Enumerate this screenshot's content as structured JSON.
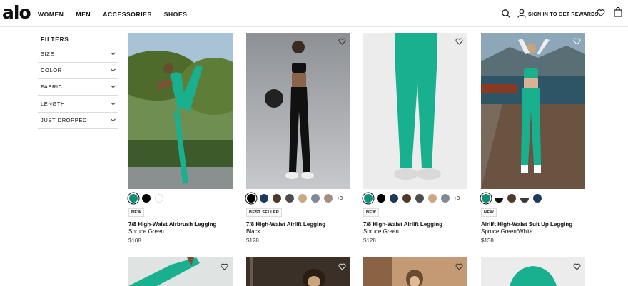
{
  "header": {
    "logo": "alo",
    "nav": [
      "WOMEN",
      "MEN",
      "ACCESSORIES",
      "SHOES"
    ],
    "signin": "SIGN IN TO GET REWARDS"
  },
  "filters": {
    "title": "FILTERS",
    "items": [
      "SIZE",
      "COLOR",
      "FABRIC",
      "LENGTH",
      "JUST DROPPED"
    ]
  },
  "products": [
    {
      "name": "7/8 High-Waist Airbrush Legging",
      "color": "Spruce Green",
      "price": "$108",
      "badge": "NEW",
      "swatches": [
        "#0f8f77",
        "#000000",
        "#ffffff"
      ],
      "more": ""
    },
    {
      "name": "7/8 High-Waist Airlift Legging",
      "color": "Black",
      "price": "$128",
      "badge": "BEST SELLER",
      "swatches": [
        "#000000",
        "#1b3a5c",
        "#4f3a2a",
        "#4d4d4d",
        "#c9a982",
        "#7f8a96",
        "#a48e83"
      ],
      "more": "+3"
    },
    {
      "name": "7/8 High-Waist Airlift Legging",
      "color": "Spruce Green",
      "price": "$128",
      "badge": "NEW",
      "swatches": [
        "#0f8f77",
        "#000000",
        "#1b3a5c",
        "#4f3a2a",
        "#4d4d4d",
        "#c9a982",
        "#7f8a96"
      ],
      "more": "+3"
    },
    {
      "name": "Airlift High-Waist Suit Up Legging",
      "color": "Spruce Green/White",
      "price": "$138",
      "badge": "NEW",
      "swatches": [
        "#0f8f77",
        "#1a1a1a",
        "#4f3a2a",
        "#3a3a3a",
        "#1b3a5c"
      ],
      "more": ""
    }
  ],
  "colors": {
    "accent": "#19b08f",
    "text": "#111111",
    "divider": "#dcdcdc"
  }
}
